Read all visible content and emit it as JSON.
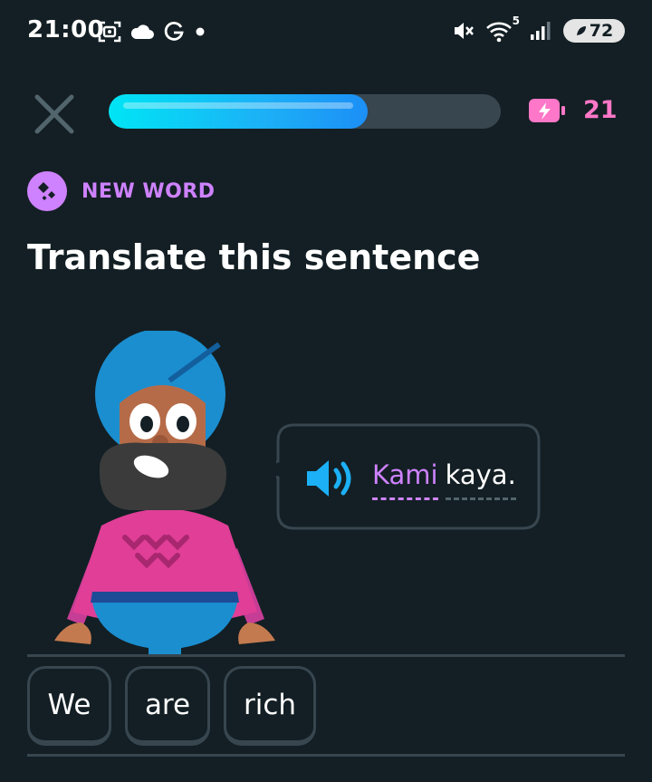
{
  "status_bar": {
    "time": "21:00",
    "left_icons": [
      "screenshot-icon",
      "cloud-icon",
      "google-icon",
      "notification-dot-icon"
    ],
    "right_icons": [
      "mute-icon",
      "wifi-icon",
      "signal-icon"
    ],
    "wifi_badge": "5",
    "battery": "72"
  },
  "header": {
    "progress_fraction": 0.66,
    "energy_count": "21",
    "energy_icon": "energy-battery-icon",
    "close_icon": "close-icon"
  },
  "lesson": {
    "badge_label": "NEW WORD",
    "title": "Translate this sentence",
    "prompt_words": [
      {
        "text": "Kami",
        "type": "new"
      },
      {
        "text": "kaya.",
        "type": "known"
      }
    ]
  },
  "answer": {
    "chips": [
      "We",
      "are",
      "rich"
    ]
  },
  "colors": {
    "background": "#131f24",
    "accent_purple": "#ce82ff",
    "progress_blue": "#1cb0f6",
    "energy_pink": "#ff77c8",
    "border_gray": "#37464f"
  }
}
